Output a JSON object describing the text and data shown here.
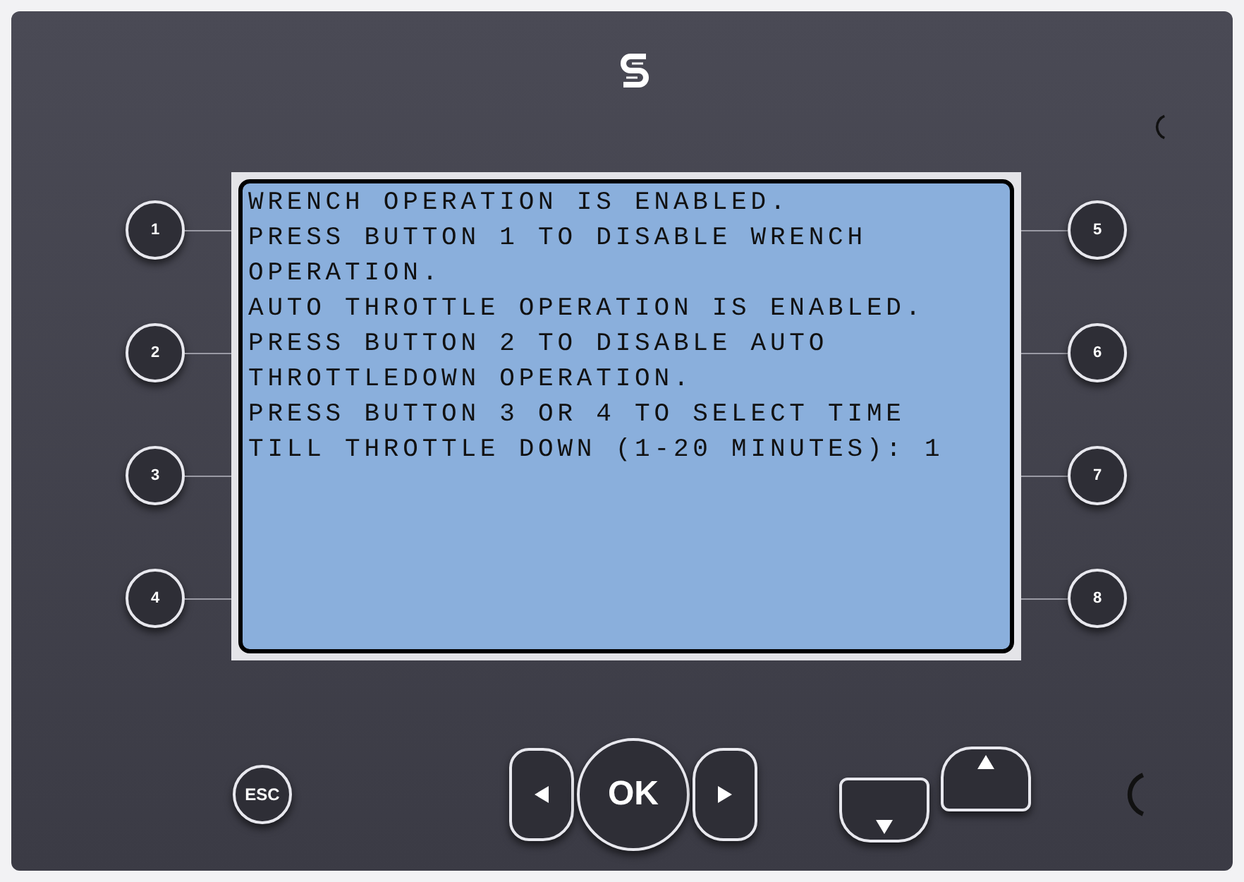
{
  "screen": {
    "lines": [
      "WRENCH OPERATION IS ENABLED.",
      "PRESS BUTTON 1 TO DISABLE WRENCH",
      "OPERATION.",
      "AUTO THROTTLE OPERATION IS ENABLED.",
      "PRESS BUTTON 2 TO DISABLE AUTO",
      "THROTTLEDOWN OPERATION.",
      "PRESS BUTTON 3 OR 4 TO SELECT TIME",
      "TILL THROTTLE DOWN (1-20 MINUTES): 1"
    ]
  },
  "left_buttons": [
    "1",
    "2",
    "3",
    "4"
  ],
  "right_buttons": [
    "5",
    "6",
    "7",
    "8"
  ],
  "controls": {
    "escape": "ESC",
    "ok": "OK"
  }
}
